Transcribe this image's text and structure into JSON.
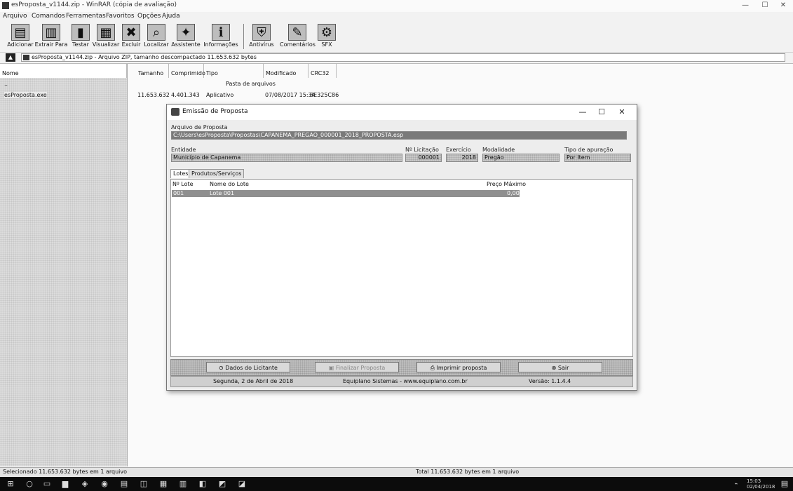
{
  "window": {
    "title": "esProposta_v1144.zip - WinRAR (cópia de avaliação)",
    "controls": {
      "minimize": "—",
      "maximize": "☐",
      "close": "✕"
    }
  },
  "menu": [
    "Arquivo",
    "Comandos",
    "Ferramentas",
    "Favoritos",
    "Opções",
    "Ajuda"
  ],
  "toolbar": [
    {
      "label": "Adicionar",
      "icon": "add-archive-icon"
    },
    {
      "label": "Extrair Para",
      "icon": "extract-icon"
    },
    {
      "label": "Testar",
      "icon": "test-icon"
    },
    {
      "label": "Visualizar",
      "icon": "view-icon"
    },
    {
      "label": "Excluir",
      "icon": "delete-icon"
    },
    {
      "label": "Localizar",
      "icon": "find-icon"
    },
    {
      "label": "Assistente",
      "icon": "wizard-icon"
    },
    {
      "label": "Informações",
      "icon": "info-icon"
    },
    {
      "label": "Antivírus",
      "icon": "antivirus-icon"
    },
    {
      "label": "Comentários",
      "icon": "comment-icon"
    },
    {
      "label": "SFX",
      "icon": "sfx-icon"
    }
  ],
  "address": "esProposta_v1144.zip - Arquivo ZIP, tamanho descompactado 11.653.632 bytes",
  "columns": {
    "name": "Nome",
    "size": "Tamanho",
    "packed": "Comprimido",
    "type": "Tipo",
    "modified": "Modificado",
    "crc": "CRC32"
  },
  "files": [
    {
      "name": "..",
      "size": "",
      "packed": "",
      "type": "Pasta de arquivos",
      "modified": "",
      "crc": ""
    },
    {
      "name": "esProposta.exe",
      "size": "11.653.632",
      "packed": "4.401.343",
      "type": "Aplicativo",
      "modified": "07/08/2017 15:34",
      "crc": "8E325C86"
    }
  ],
  "dialog": {
    "title": "Emissão de Proposta",
    "file_label": "Arquivo de Proposta",
    "file_value": "C:\\Users\\esProposta\\Propostas\\CAPANEMA_PREGAO_000001_2018_PROPOSTA.esp",
    "entity_label": "Entidade",
    "entity_value": "Município de Capanema",
    "licitacao_label": "Nº Licitação",
    "licitacao_value": "000001",
    "exercicio_label": "Exercício",
    "exercicio_value": "2018",
    "modalidade_label": "Modalidade",
    "modalidade_value": "Pregão",
    "apuracao_label": "Tipo de apuração",
    "apuracao_value": "Por Item",
    "tabs": [
      "Lotes",
      "Produtos/Serviços"
    ],
    "grid_headers": {
      "lote": "Nº Lote",
      "nome": "Nome do Lote",
      "preco": "Preço Máximo"
    },
    "grid_row": {
      "lote": "001",
      "nome": "Lote 001",
      "preco": "0,00"
    },
    "buttons": [
      "Dados do Licitante",
      "Finalizar Proposta",
      "Imprimir proposta",
      "Sair"
    ],
    "status": {
      "date": "Segunda, 2 de Abril de 2018",
      "company": "Equiplano Sistemas - www.equiplano.com.br",
      "version": "Versão: 1.1.4.4"
    }
  },
  "statusbar": {
    "left": "Selecionado 11.653.632 bytes em 1 arquivo",
    "right": "Total 11.653.632 bytes em 1 arquivo"
  },
  "tray": {
    "time": "15:03",
    "date": "02/04/2018"
  }
}
